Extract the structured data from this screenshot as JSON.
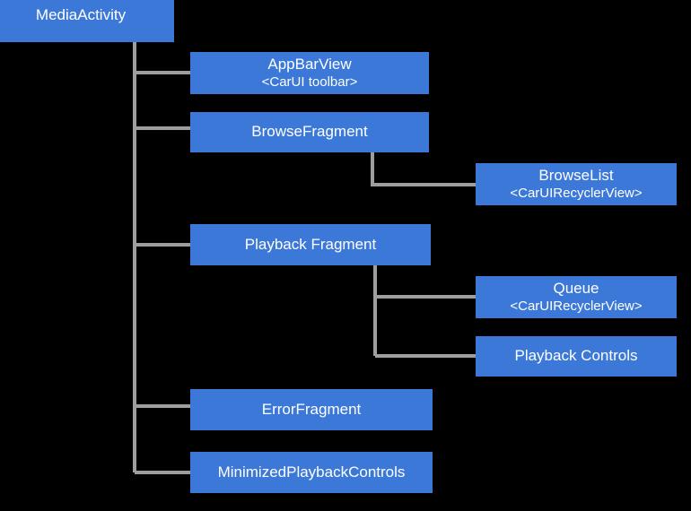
{
  "diagram": {
    "type": "hierarchy-tree",
    "background_color": "#000000",
    "node_fill_color": "#3c78d8",
    "node_text_color": "#ffffff",
    "connector_color": "#9e9e9e",
    "nodes": [
      {
        "id": "media-activity",
        "title": "MediaActivity",
        "subtitle": ""
      },
      {
        "id": "app-bar-view",
        "title": "AppBarView",
        "subtitle": "<CarUI toolbar>"
      },
      {
        "id": "browse-fragment",
        "title": "BrowseFragment",
        "subtitle": ""
      },
      {
        "id": "browse-list",
        "title": "BrowseList",
        "subtitle": "<CarUIRecyclerView>"
      },
      {
        "id": "playback-fragment",
        "title": "Playback Fragment",
        "subtitle": ""
      },
      {
        "id": "queue",
        "title": "Queue",
        "subtitle": "<CarUIRecyclerView>"
      },
      {
        "id": "playback-controls",
        "title": "Playback Controls",
        "subtitle": ""
      },
      {
        "id": "error-fragment",
        "title": "ErrorFragment",
        "subtitle": ""
      },
      {
        "id": "minimized-controls",
        "title": "MinimizedPlaybackControls",
        "subtitle": ""
      }
    ],
    "edges": [
      {
        "from": "media-activity",
        "to": "app-bar-view"
      },
      {
        "from": "media-activity",
        "to": "browse-fragment"
      },
      {
        "from": "media-activity",
        "to": "playback-fragment"
      },
      {
        "from": "media-activity",
        "to": "error-fragment"
      },
      {
        "from": "media-activity",
        "to": "minimized-controls"
      },
      {
        "from": "browse-fragment",
        "to": "browse-list"
      },
      {
        "from": "playback-fragment",
        "to": "queue"
      },
      {
        "from": "playback-fragment",
        "to": "playback-controls"
      }
    ]
  }
}
